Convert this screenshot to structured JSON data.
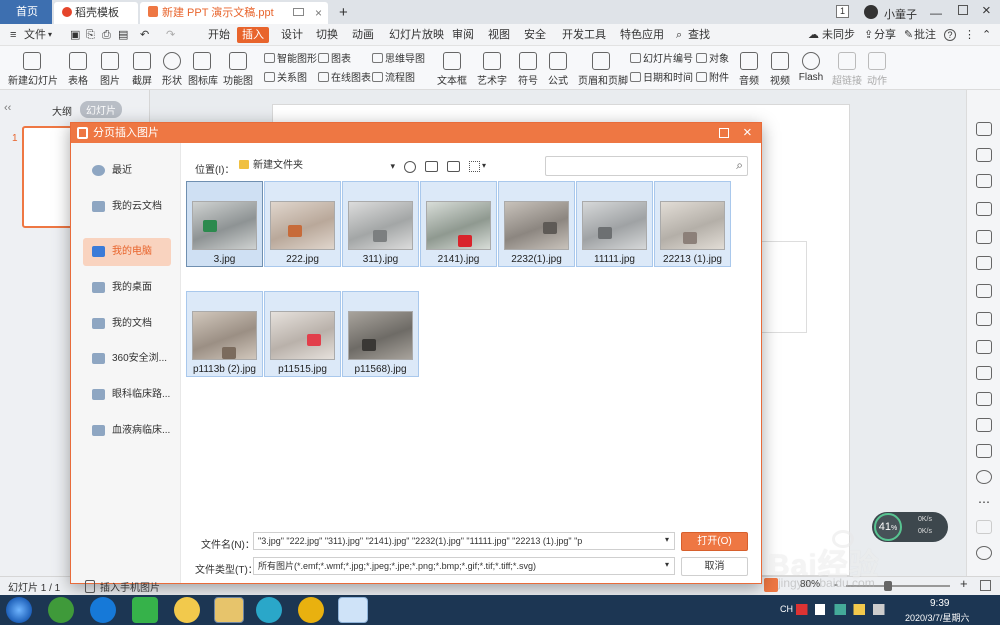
{
  "tabs": {
    "home": "首页",
    "template": "稻壳模板",
    "doc": "新建 PPT 演示文稿.ppt",
    "add": "+",
    "badge": "1",
    "user": "小童子"
  },
  "menu": {
    "file": "文件",
    "items": [
      "开始",
      "插入",
      "设计",
      "切换",
      "动画",
      "幻灯片放映",
      "审阅",
      "视图",
      "安全",
      "开发工具",
      "特色应用"
    ],
    "search": "查找",
    "sync": "未同步",
    "share": "分享",
    "comment": "批注",
    "help": "?"
  },
  "ribbon": {
    "large": [
      "新建幻灯片",
      "表格",
      "图片",
      "截屏",
      "形状",
      "图标库",
      "功能图",
      "文本框",
      "艺术字",
      "符号",
      "公式",
      "页眉和页脚",
      "音频",
      "视频",
      "Flash",
      "超链接",
      "动作"
    ],
    "small": [
      "智能图形",
      "图表",
      "思维导图",
      "关系图",
      "在线图表",
      "流程图",
      "幻灯片编号",
      "对象",
      "日期和时间",
      "附件"
    ]
  },
  "leftpanel": {
    "tab_outline": "大纲",
    "tab_slides": "幻灯片",
    "slide_number": "1"
  },
  "dialog": {
    "title": "分页插入图片",
    "location_label": "位置(I)：",
    "location_value": "新建文件夹",
    "search_placeholder": "",
    "sidebar": [
      "最近",
      "我的云文档",
      "我的电脑",
      "我的桌面",
      "我的文档",
      "360安全浏...",
      "眼科临床路...",
      "血液病临床..."
    ],
    "sidebar_active": "我的电脑",
    "phone_image": "插入手机图片",
    "files": [
      {
        "name": "3.jpg"
      },
      {
        "name": "222.jpg"
      },
      {
        "name": "311).jpg"
      },
      {
        "name": "2141).jpg"
      },
      {
        "name": "2232(1).jpg"
      },
      {
        "name": "11111.jpg"
      },
      {
        "name": "22213 (1).jpg"
      },
      {
        "name": "p1113b (2).jpg"
      },
      {
        "name": "p11515.jpg"
      },
      {
        "name": "p11568).jpg"
      }
    ],
    "filename_label": "文件名(N)：",
    "filename_value": "\"3.jpg\" \"222.jpg\" \"311).jpg\" \"2141).jpg\" \"2232(1).jpg\" \"11111.jpg\" \"22213 (1).jpg\" \"p",
    "filetype_label": "文件类型(T)：",
    "filetype_value": "所有图片(*.emf;*.wmf;*.jpg;*.jpeg;*.jpe;*.png;*.bmp;*.gif;*.tif;*.tiff;*.svg)",
    "open_button": "打开(O)",
    "cancel_button": "取消"
  },
  "status": {
    "slide_info": "幻灯片 1 / 1",
    "zoom": "80%",
    "minus": "-",
    "plus": "+"
  },
  "overlay": {
    "gauge": "41",
    "gauge_unit": "%",
    "net_up": "0K/s",
    "net_down": "0K/s"
  },
  "watermark": {
    "brand": "Bai经验",
    "url": "jingyan.baidu.com"
  },
  "taskbar": {
    "tray_lang": "CH",
    "time": "9:39",
    "date": "2020/3/7/星期六"
  },
  "colors": {
    "accent": "#ee7743",
    "selected_tab": "#e8642c",
    "taskbar": "#1c3653"
  }
}
